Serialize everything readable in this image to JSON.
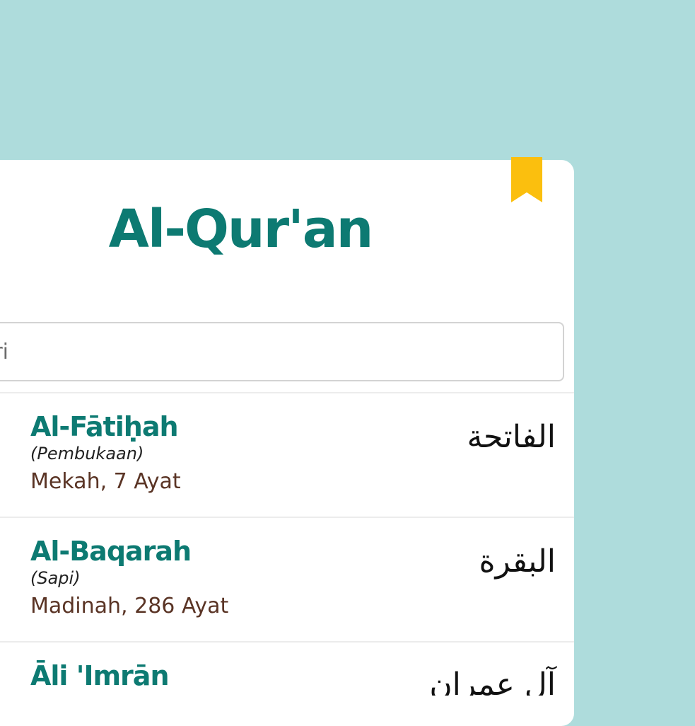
{
  "header": {
    "title": "Al-Qur'an"
  },
  "search": {
    "value": "",
    "placeholder": "Cari"
  },
  "surahs": [
    {
      "name": "Al-Fātiḥah",
      "meaning": "(Pembukaan)",
      "info": "Mekah, 7 Ayat",
      "arabic": "الفاتحة"
    },
    {
      "name": "Al-Baqarah",
      "meaning": "(Sapi)",
      "info": "Madinah, 286 Ayat",
      "arabic": "البقرة"
    },
    {
      "name": "Āli 'Imrān",
      "meaning": "",
      "info": "",
      "arabic": "آل عمران"
    }
  ],
  "colors": {
    "background": "#aedcdc",
    "accent": "#0d7a72",
    "bookmark": "#fbbf0e",
    "info_text": "#5a3425"
  },
  "icons": {
    "bookmark": "bookmark-icon"
  }
}
